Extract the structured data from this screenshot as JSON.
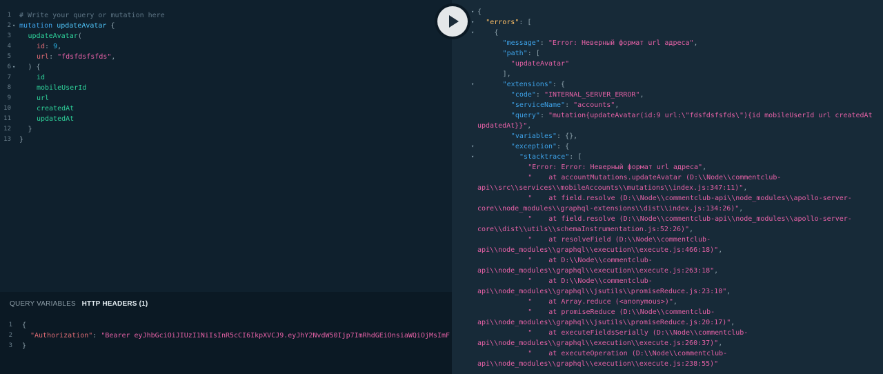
{
  "editor": {
    "lines": [
      {
        "num": "1",
        "fold": false,
        "indent": 0,
        "tokens": [
          {
            "t": "# Write your query or mutation here",
            "c": "comment"
          }
        ]
      },
      {
        "num": "2",
        "fold": true,
        "indent": 0,
        "tokens": [
          {
            "t": "mutation",
            "c": "kw"
          },
          {
            "t": " "
          },
          {
            "t": "updateAvatar",
            "c": "name"
          },
          {
            "t": " {",
            "c": "punc"
          }
        ]
      },
      {
        "num": "3",
        "fold": false,
        "indent": 1,
        "tokens": [
          {
            "t": "updateAvatar",
            "c": "field"
          },
          {
            "t": "(",
            "c": "punc"
          }
        ]
      },
      {
        "num": "4",
        "fold": false,
        "indent": 2,
        "tokens": [
          {
            "t": "id",
            "c": "arg"
          },
          {
            "t": ": ",
            "c": "punc"
          },
          {
            "t": "9",
            "c": "num"
          },
          {
            "t": ",",
            "c": "punc"
          }
        ]
      },
      {
        "num": "5",
        "fold": false,
        "indent": 2,
        "tokens": [
          {
            "t": "url",
            "c": "arg"
          },
          {
            "t": ": ",
            "c": "punc"
          },
          {
            "t": "\"fdsfdsfsfds\"",
            "c": "str"
          },
          {
            "t": ",",
            "c": "punc"
          }
        ]
      },
      {
        "num": "6",
        "fold": true,
        "indent": 1,
        "tokens": [
          {
            "t": ") {",
            "c": "punc"
          }
        ]
      },
      {
        "num": "7",
        "fold": false,
        "indent": 2,
        "tokens": [
          {
            "t": "id",
            "c": "field"
          }
        ]
      },
      {
        "num": "8",
        "fold": false,
        "indent": 2,
        "tokens": [
          {
            "t": "mobileUserId",
            "c": "field"
          }
        ]
      },
      {
        "num": "9",
        "fold": false,
        "indent": 2,
        "tokens": [
          {
            "t": "url",
            "c": "field"
          }
        ]
      },
      {
        "num": "10",
        "fold": false,
        "indent": 2,
        "tokens": [
          {
            "t": "createdAt",
            "c": "field"
          }
        ]
      },
      {
        "num": "11",
        "fold": false,
        "indent": 2,
        "tokens": [
          {
            "t": "updatedAt",
            "c": "field"
          }
        ]
      },
      {
        "num": "12",
        "fold": false,
        "indent": 1,
        "tokens": [
          {
            "t": "}",
            "c": "punc"
          }
        ]
      },
      {
        "num": "13",
        "fold": false,
        "indent": 0,
        "tokens": [
          {
            "t": "}",
            "c": "punc"
          }
        ]
      }
    ]
  },
  "variables_panel": {
    "tab_query_variables": "QUERY VARIABLES",
    "tab_http_headers": "HTTP HEADERS (1)",
    "lines": [
      {
        "num": "1",
        "indent": 0,
        "tokens": [
          {
            "t": "{",
            "c": "punc"
          }
        ]
      },
      {
        "num": "2",
        "indent": 1,
        "tokens": [
          {
            "t": "\"Authorization\"",
            "c": "hkey"
          },
          {
            "t": ": ",
            "c": "punc"
          },
          {
            "t": "\"Bearer eyJhbGciOiJIUzI1NiIsInR5cCI6IkpXVCJ9.eyJhY2NvdW50Ijp7ImRhdGEiOnsiaWQiOjMsImF",
            "c": "hval"
          }
        ]
      },
      {
        "num": "3",
        "indent": 0,
        "tokens": [
          {
            "t": "}",
            "c": "punc"
          }
        ]
      }
    ]
  },
  "run_button": {
    "icon": "play-icon"
  },
  "result": {
    "lines": [
      {
        "fold": true,
        "indent": 0,
        "tokens": [
          {
            "t": "{",
            "c": "punc"
          }
        ]
      },
      {
        "fold": true,
        "indent": 1,
        "tokens": [
          {
            "t": "\"errors\"",
            "c": "key"
          },
          {
            "t": ": [",
            "c": "punc"
          }
        ]
      },
      {
        "fold": true,
        "indent": 2,
        "tokens": [
          {
            "t": "{",
            "c": "punc"
          }
        ]
      },
      {
        "fold": false,
        "indent": 3,
        "tokens": [
          {
            "t": "\"message\"",
            "c": "key2"
          },
          {
            "t": ": ",
            "c": "punc"
          },
          {
            "t": "\"Error: Неверный формат url адреса\"",
            "c": "str"
          },
          {
            "t": ",",
            "c": "punc"
          }
        ]
      },
      {
        "fold": false,
        "indent": 3,
        "tokens": [
          {
            "t": "\"path\"",
            "c": "key2"
          },
          {
            "t": ": [",
            "c": "punc"
          }
        ]
      },
      {
        "fold": false,
        "indent": 4,
        "tokens": [
          {
            "t": "\"updateAvatar\"",
            "c": "str"
          }
        ]
      },
      {
        "fold": false,
        "indent": 3,
        "tokens": [
          {
            "t": "],",
            "c": "punc"
          }
        ]
      },
      {
        "fold": true,
        "indent": 3,
        "tokens": [
          {
            "t": "\"extensions\"",
            "c": "key2"
          },
          {
            "t": ": {",
            "c": "punc"
          }
        ]
      },
      {
        "fold": false,
        "indent": 4,
        "tokens": [
          {
            "t": "\"code\"",
            "c": "key2"
          },
          {
            "t": ": ",
            "c": "punc"
          },
          {
            "t": "\"INTERNAL_SERVER_ERROR\"",
            "c": "str"
          },
          {
            "t": ",",
            "c": "punc"
          }
        ]
      },
      {
        "fold": false,
        "indent": 4,
        "tokens": [
          {
            "t": "\"serviceName\"",
            "c": "key2"
          },
          {
            "t": ": ",
            "c": "punc"
          },
          {
            "t": "\"accounts\"",
            "c": "str"
          },
          {
            "t": ",",
            "c": "punc"
          }
        ]
      },
      {
        "fold": false,
        "indent": 4,
        "tokens": [
          {
            "t": "\"query\"",
            "c": "key2"
          },
          {
            "t": ": ",
            "c": "punc"
          },
          {
            "t": "\"mutation{updateAvatar(id:9 url:\\\"fdsfdsfsfds\\\"){id mobileUserId url createdAt",
            "c": "str"
          }
        ]
      },
      {
        "fold": false,
        "indent": 0,
        "tokens": [
          {
            "t": "updatedAt}}\"",
            "c": "str"
          },
          {
            "t": ",",
            "c": "punc"
          }
        ]
      },
      {
        "fold": false,
        "indent": 4,
        "tokens": [
          {
            "t": "\"variables\"",
            "c": "key2"
          },
          {
            "t": ": {},",
            "c": "punc"
          }
        ]
      },
      {
        "fold": true,
        "indent": 4,
        "tokens": [
          {
            "t": "\"exception\"",
            "c": "key2"
          },
          {
            "t": ": {",
            "c": "punc"
          }
        ]
      },
      {
        "fold": true,
        "indent": 5,
        "tokens": [
          {
            "t": "\"stacktrace\"",
            "c": "key2"
          },
          {
            "t": ": [",
            "c": "punc"
          }
        ]
      },
      {
        "fold": false,
        "indent": 6,
        "tokens": [
          {
            "t": "\"Error: Error: Неверный формат url адреса\"",
            "c": "str"
          },
          {
            "t": ",",
            "c": "punc"
          }
        ]
      },
      {
        "fold": false,
        "indent": 6,
        "tokens": [
          {
            "t": "\"    at accountMutations.updateAvatar (D:\\\\Node\\\\commentclub-",
            "c": "str"
          }
        ]
      },
      {
        "fold": false,
        "indent": 0,
        "tokens": [
          {
            "t": "api\\\\src\\\\services\\\\mobileAccounts\\\\mutations\\\\index.js:347:11)\"",
            "c": "str"
          },
          {
            "t": ",",
            "c": "punc"
          }
        ]
      },
      {
        "fold": false,
        "indent": 6,
        "tokens": [
          {
            "t": "\"    at field.resolve (D:\\\\Node\\\\commentclub-api\\\\node_modules\\\\apollo-server-",
            "c": "str"
          }
        ]
      },
      {
        "fold": false,
        "indent": 0,
        "tokens": [
          {
            "t": "core\\\\node_modules\\\\graphql-extensions\\\\dist\\\\index.js:134:26)\"",
            "c": "str"
          },
          {
            "t": ",",
            "c": "punc"
          }
        ]
      },
      {
        "fold": false,
        "indent": 6,
        "tokens": [
          {
            "t": "\"    at field.resolve (D:\\\\Node\\\\commentclub-api\\\\node_modules\\\\apollo-server-",
            "c": "str"
          }
        ]
      },
      {
        "fold": false,
        "indent": 0,
        "tokens": [
          {
            "t": "core\\\\dist\\\\utils\\\\schemaInstrumentation.js:52:26)\"",
            "c": "str"
          },
          {
            "t": ",",
            "c": "punc"
          }
        ]
      },
      {
        "fold": false,
        "indent": 6,
        "tokens": [
          {
            "t": "\"    at resolveField (D:\\\\Node\\\\commentclub-",
            "c": "str"
          }
        ]
      },
      {
        "fold": false,
        "indent": 0,
        "tokens": [
          {
            "t": "api\\\\node_modules\\\\graphql\\\\execution\\\\execute.js:466:18)\"",
            "c": "str"
          },
          {
            "t": ",",
            "c": "punc"
          }
        ]
      },
      {
        "fold": false,
        "indent": 6,
        "tokens": [
          {
            "t": "\"    at D:\\\\Node\\\\commentclub-",
            "c": "str"
          }
        ]
      },
      {
        "fold": false,
        "indent": 0,
        "tokens": [
          {
            "t": "api\\\\node_modules\\\\graphql\\\\execution\\\\execute.js:263:18\"",
            "c": "str"
          },
          {
            "t": ",",
            "c": "punc"
          }
        ]
      },
      {
        "fold": false,
        "indent": 6,
        "tokens": [
          {
            "t": "\"    at D:\\\\Node\\\\commentclub-",
            "c": "str"
          }
        ]
      },
      {
        "fold": false,
        "indent": 0,
        "tokens": [
          {
            "t": "api\\\\node_modules\\\\graphql\\\\jsutils\\\\promiseReduce.js:23:10\"",
            "c": "str"
          },
          {
            "t": ",",
            "c": "punc"
          }
        ]
      },
      {
        "fold": false,
        "indent": 6,
        "tokens": [
          {
            "t": "\"    at Array.reduce (<anonymous>)\"",
            "c": "str"
          },
          {
            "t": ",",
            "c": "punc"
          }
        ]
      },
      {
        "fold": false,
        "indent": 6,
        "tokens": [
          {
            "t": "\"    at promiseReduce (D:\\\\Node\\\\commentclub-",
            "c": "str"
          }
        ]
      },
      {
        "fold": false,
        "indent": 0,
        "tokens": [
          {
            "t": "api\\\\node_modules\\\\graphql\\\\jsutils\\\\promiseReduce.js:20:17)\"",
            "c": "str"
          },
          {
            "t": ",",
            "c": "punc"
          }
        ]
      },
      {
        "fold": false,
        "indent": 6,
        "tokens": [
          {
            "t": "\"    at executeFieldsSerially (D:\\\\Node\\\\commentclub-",
            "c": "str"
          }
        ]
      },
      {
        "fold": false,
        "indent": 0,
        "tokens": [
          {
            "t": "api\\\\node_modules\\\\graphql\\\\execution\\\\execute.js:260:37)\"",
            "c": "str"
          },
          {
            "t": ",",
            "c": "punc"
          }
        ]
      },
      {
        "fold": false,
        "indent": 6,
        "tokens": [
          {
            "t": "\"    at executeOperation (D:\\\\Node\\\\commentclub-",
            "c": "str"
          }
        ]
      },
      {
        "fold": false,
        "indent": 0,
        "tokens": [
          {
            "t": "api\\\\node_modules\\\\graphql\\\\execution\\\\execute.js:238:55)\"",
            "c": "str"
          }
        ]
      }
    ]
  }
}
